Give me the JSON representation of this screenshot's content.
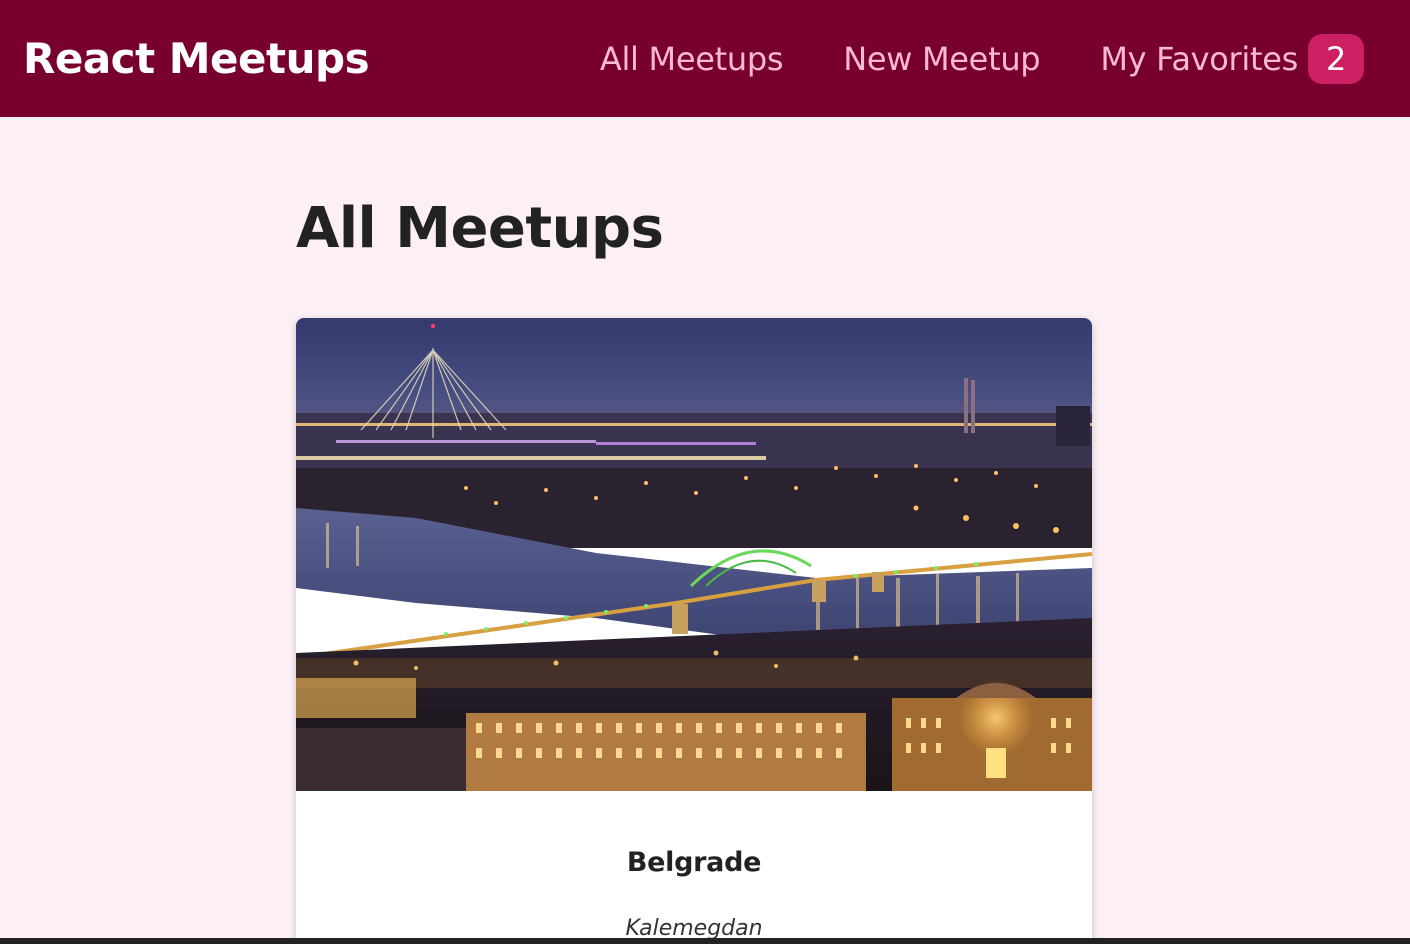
{
  "header": {
    "logo": "React Meetups",
    "nav": [
      {
        "label": "All Meetups"
      },
      {
        "label": "New Meetup"
      },
      {
        "label": "My Favorites",
        "badge": "2"
      }
    ],
    "colors": {
      "background": "#77002e",
      "link": "#fcb8d6",
      "badge": "#cc2062"
    }
  },
  "main": {
    "title": "All Meetups",
    "meetups": [
      {
        "title": "Belgrade",
        "address": "Kalemegdan",
        "image": "night-city-river-bridges-photo"
      }
    ]
  }
}
